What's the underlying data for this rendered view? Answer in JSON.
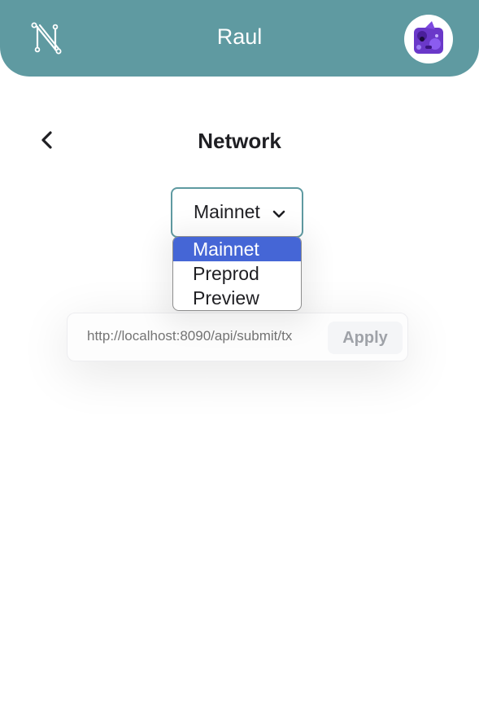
{
  "header": {
    "account_name": "Raul",
    "logo_icon": "n-network-logo",
    "avatar_icon": "nft-avatar",
    "background_color": "#5f9aa1"
  },
  "page": {
    "title": "Network",
    "back_icon": "chevron-left-icon"
  },
  "network_select": {
    "selected": "Mainnet",
    "options": [
      "Mainnet",
      "Preprod",
      "Preview"
    ],
    "highlight_color": "#4566d6"
  },
  "submit_url": {
    "placeholder": "http://localhost:8090/api/submit/tx",
    "apply_label": "Apply"
  }
}
